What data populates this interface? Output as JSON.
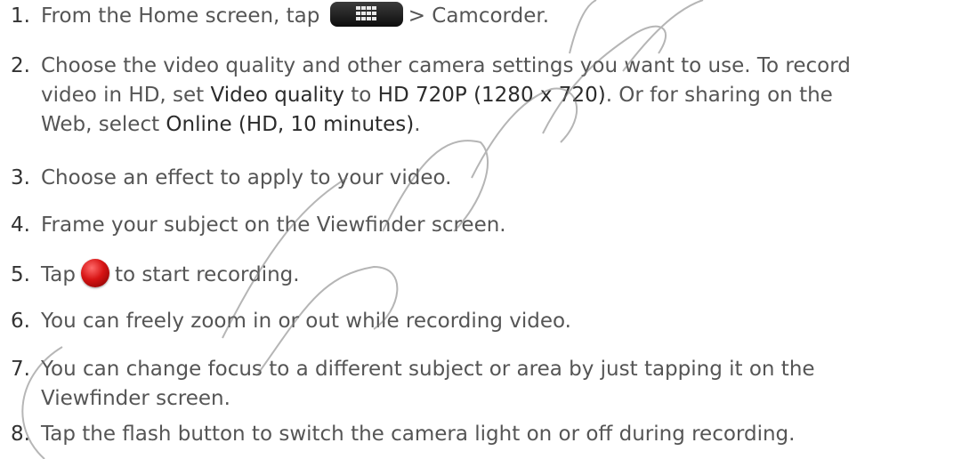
{
  "steps": [
    {
      "number": "1.",
      "before": "From the Home screen, tap",
      "after": "> Camcorder."
    },
    {
      "number": "2.",
      "line1": "Choose the video quality and other camera settings you want to use. To record",
      "line2_pre": "video in HD, set ",
      "line2_ui1": "Video quality",
      "line2_mid": " to ",
      "line2_ui2": "HD 720P (1280 x 720)",
      "line2_post": ". Or for sharing on the",
      "line3_pre": "Web, select ",
      "line3_ui": "Online (HD, 10 minutes)",
      "line3_post": "."
    },
    {
      "number": "3.",
      "text": "Choose an effect to apply to your video."
    },
    {
      "number": "4.",
      "text": "Frame your subject on the Viewfinder screen."
    },
    {
      "number": "5.",
      "before": "Tap",
      "after": "to start recording."
    },
    {
      "number": "6.",
      "text": "You can freely zoom in or out while recording video."
    },
    {
      "number": "7.",
      "line1": "You can change focus to a different subject or area by just tapping it on the",
      "line2": "Viewfinder screen."
    },
    {
      "number": "8.",
      "text": "Tap the flash button to switch the camera light on or off during recording."
    }
  ],
  "icons": {
    "app_launcher": "all-apps-grid-icon",
    "record": "record-button-icon"
  },
  "colors": {
    "body_text": "#555555",
    "record_red": "#d71414",
    "watermark": "#7a7a7a"
  }
}
